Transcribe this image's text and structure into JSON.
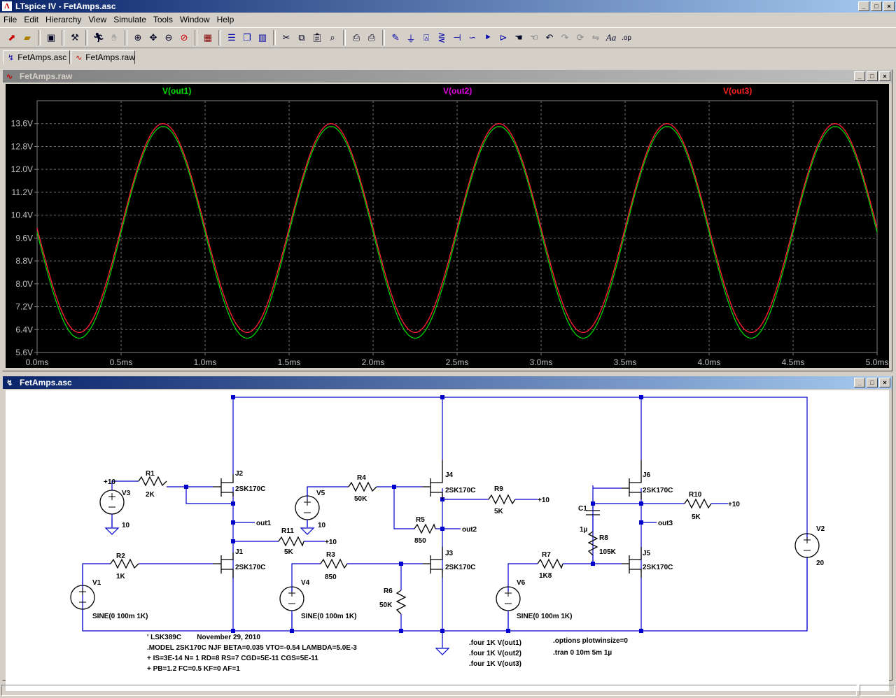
{
  "window": {
    "title": "LTspice IV - FetAmps.asc",
    "app_icon": "ltspice-logo-icon"
  },
  "menu": [
    "File",
    "Edit",
    "Hierarchy",
    "View",
    "Simulate",
    "Tools",
    "Window",
    "Help"
  ],
  "toolbar_icons": [
    "new-schematic-icon",
    "open-icon",
    "save-icon",
    "control-panel-icon",
    "run-icon",
    "halt-icon",
    "zoom-in-icon",
    "zoom-pan-icon",
    "zoom-out-icon",
    "zoom-cancel-icon",
    "autorange-icon",
    "tile-horizontal-icon",
    "cascade-icon",
    "tile-vertical-icon",
    "cut-icon",
    "copy-icon",
    "paste-icon",
    "find-icon",
    "print-setup-icon",
    "print-icon",
    "draw-wire-icon",
    "ground-icon",
    "label-net-icon",
    "resistor-icon",
    "capacitor-icon",
    "inductor-icon",
    "diode-icon",
    "component-icon",
    "move-icon",
    "drag-icon",
    "undo-icon",
    "redo-icon",
    "rotate-icon",
    "mirror-icon",
    "text-icon",
    "spice-directive-icon"
  ],
  "tabs": [
    {
      "label": "FetAmps.asc",
      "icon": "schematic-icon"
    },
    {
      "label": "FetAmps.raw",
      "icon": "waveform-icon"
    }
  ],
  "plot_window": {
    "title": "FetAmps.raw"
  },
  "schematic_window": {
    "title": "FetAmps.asc"
  },
  "chart_data": {
    "type": "line",
    "x_unit": "ms",
    "x_range": [
      0,
      5
    ],
    "y_range": [
      5.6,
      14.4
    ],
    "x_ticks": [
      "0.0ms",
      "0.5ms",
      "1.0ms",
      "1.5ms",
      "2.0ms",
      "2.5ms",
      "3.0ms",
      "3.5ms",
      "4.0ms",
      "4.5ms",
      "5.0ms"
    ],
    "y_ticks": [
      "5.6V",
      "6.4V",
      "7.2V",
      "8.0V",
      "8.8V",
      "9.6V",
      "10.4V",
      "11.2V",
      "12.0V",
      "12.8V",
      "13.6V"
    ],
    "grid": true,
    "series": [
      {
        "name": "V(out1)",
        "color": "#00e000",
        "offset": 9.8,
        "amplitude": 3.7,
        "period_ms": 1
      },
      {
        "name": "V(out2)",
        "color": "#e000e0",
        "offset": 9.95,
        "amplitude": 3.65,
        "period_ms": 1
      },
      {
        "name": "V(out3)",
        "color": "#ff2020",
        "offset": 9.95,
        "amplitude": 3.65,
        "period_ms": 1
      }
    ]
  },
  "schematic": {
    "labels": {
      "r1": "R1",
      "r1v": "2K",
      "r2": "R2",
      "r2v": "1K",
      "r3": "R3",
      "r3v": "850",
      "r4": "R4",
      "r4v": "50K",
      "r5": "R5",
      "r5v": "850",
      "r6": "R6",
      "r6v": "50K",
      "r7": "R7",
      "r7v": "1K8",
      "r8": "R8",
      "r8v": "105K",
      "r9": "R9",
      "r9v": "5K",
      "r10": "R10",
      "r10v": "5K",
      "r11": "R11",
      "r11v": "5K",
      "c1": "C1",
      "c1v": "1µ",
      "j1": "J1",
      "j2": "J2",
      "j3": "J3",
      "j4": "J4",
      "j5": "J5",
      "j6": "J6",
      "jmodel": "2SK170C",
      "v1": "V1",
      "v2": "V2",
      "v2v": "20",
      "v3": "V3",
      "v4": "V4",
      "v5": "V5",
      "v6": "V6",
      "sine": "SINE(0 100m 1K)",
      "ten": "10",
      "plus10": "+10",
      "out1": "out1",
      "out2": "out2",
      "out3": "out3"
    },
    "comment": [
      "' LSK389C        November 29, 2010",
      ".MODEL 2SK170C NJF BETA=0.035 VTO=-0.54 LAMBDA=5.0E-3",
      "+ IS=3E-14 N= 1 RD=8 RS=7 CGD=5E-11 CGS=5E-11",
      "+ PB=1.2 FC=0.5 KF=0 AF=1"
    ],
    "four": [
      ".four 1K V(out1)",
      ".four 1K V(out2)",
      ".four 1K V(out3)"
    ],
    "options": [
      ".options plotwinsize=0",
      ".tran 0 10m 5m 1µ"
    ]
  }
}
